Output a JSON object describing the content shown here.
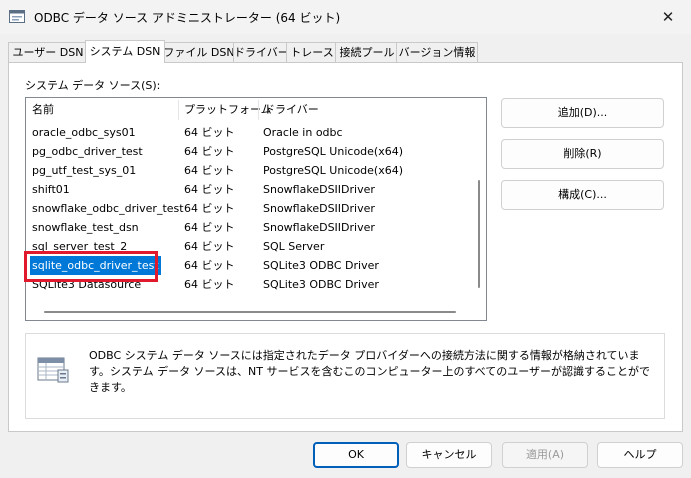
{
  "window": {
    "title": "ODBC データ ソース アドミニストレーター (64 ビット)",
    "close_glyph": "✕"
  },
  "tabs": [
    {
      "label": "ユーザー DSN"
    },
    {
      "label": "システム DSN",
      "active": true
    },
    {
      "label": "ファイル DSN"
    },
    {
      "label": "ドライバー"
    },
    {
      "label": "トレース"
    },
    {
      "label": "接続プール"
    },
    {
      "label": "バージョン情報"
    }
  ],
  "system_dsn": {
    "label": "システム データ ソース(S):",
    "columns": {
      "name": "名前",
      "platform": "プラットフォーム",
      "driver": "ドライバー"
    },
    "rows": [
      {
        "name": "oracle_odbc_sys01",
        "platform": "64 ビット",
        "driver": "Oracle in odbc"
      },
      {
        "name": "pg_odbc_driver_test",
        "platform": "64 ビット",
        "driver": "PostgreSQL Unicode(x64)"
      },
      {
        "name": "pg_utf_test_sys_01",
        "platform": "64 ビット",
        "driver": "PostgreSQL Unicode(x64)"
      },
      {
        "name": "shift01",
        "platform": "64 ビット",
        "driver": "SnowflakeDSIIDriver"
      },
      {
        "name": "snowflake_odbc_driver_test",
        "platform": "64 ビット",
        "driver": "SnowflakeDSIIDriver"
      },
      {
        "name": "snowflake_test_dsn",
        "platform": "64 ビット",
        "driver": "SnowflakeDSIIDriver"
      },
      {
        "name": "sql_server_test_2",
        "platform": "64 ビット",
        "driver": "SQL Server"
      },
      {
        "name": "sqlite_odbc_driver_test",
        "platform": "64 ビット",
        "driver": "SQLite3 ODBC Driver",
        "selected": true
      },
      {
        "name": "SQLite3 Datasource",
        "platform": "64 ビット",
        "driver": "SQLite3 ODBC Driver"
      }
    ],
    "buttons": {
      "add": "追加(D)...",
      "remove": "削除(R)",
      "configure": "構成(C)..."
    },
    "info_text": "ODBC システム データ ソースには指定されたデータ プロバイダーへの接続方法に関する情報が格納されています。システム データ ソースは、NT サービスを含むこのコンピューター上のすべてのユーザーが認識することができます。"
  },
  "footer": {
    "ok": "OK",
    "cancel": "キャンセル",
    "apply": "適用(A)",
    "help": "ヘルプ"
  },
  "colors": {
    "selection": "#0078d7",
    "highlight_border": "#e0192c",
    "primary_border": "#005fb8"
  }
}
